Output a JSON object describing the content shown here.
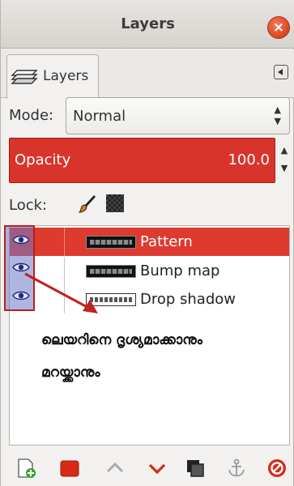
{
  "window": {
    "title": "Layers",
    "close_glyph": "×"
  },
  "tab": {
    "label": "Layers",
    "icon": "layers-stack-icon"
  },
  "mode": {
    "label": "Mode:",
    "value": "Normal"
  },
  "opacity": {
    "label": "Opacity",
    "value": "100.0",
    "fill_color": "#d9342b"
  },
  "lock": {
    "label": "Lock:",
    "icons": [
      "paintbrush-icon",
      "alpha-checkerboard-icon"
    ]
  },
  "layers": [
    {
      "name": "Pattern",
      "selected": true,
      "visible": true,
      "thumb": "dark"
    },
    {
      "name": "Bump map",
      "selected": false,
      "visible": true,
      "thumb": "dark"
    },
    {
      "name": "Drop shadow",
      "selected": false,
      "visible": true,
      "thumb": "white"
    }
  ],
  "annotation": {
    "line1": "ലെയറിനെ ദൃശ്യമാക്കാനും",
    "line2": "മറയ്ക്കാനും",
    "highlight_color": "#b8201c"
  },
  "toolbar": {
    "buttons": [
      "new-layer-icon",
      "new-layer-group-icon",
      "raise-layer-icon",
      "lower-layer-icon",
      "duplicate-layer-icon",
      "anchor-layer-icon",
      "delete-layer-icon"
    ]
  }
}
